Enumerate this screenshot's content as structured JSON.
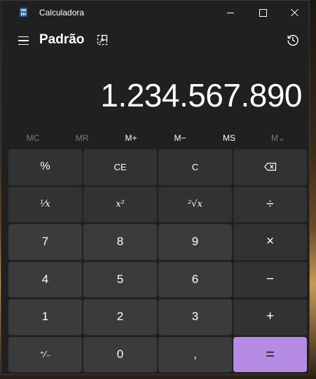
{
  "window": {
    "app_title": "Calculadora"
  },
  "header": {
    "mode": "Padrão"
  },
  "display": {
    "value": "1.234.567.890"
  },
  "memory": {
    "mc": "MC",
    "mr": "MR",
    "mplus": "M+",
    "mminus": "M−",
    "ms": "MS",
    "mlist": "M⌄"
  },
  "keys": {
    "percent": "%",
    "ce": "CE",
    "c": "C",
    "reciprocal": "⅟x",
    "square": "x²",
    "sqrt": "²√x",
    "divide": "÷",
    "seven": "7",
    "eight": "8",
    "nine": "9",
    "multiply": "×",
    "four": "4",
    "five": "5",
    "six": "6",
    "minus": "−",
    "one": "1",
    "two": "2",
    "three": "3",
    "plus": "+",
    "negate": "⁺∕₋",
    "zero": "0",
    "decimal": ",",
    "equals": "="
  },
  "icons": {
    "app": "calculator-app-icon",
    "menu": "hamburger-menu-icon",
    "keep_on_top": "keep-on-top-icon",
    "history": "history-icon",
    "backspace": "backspace-icon"
  },
  "colors": {
    "accent": "#b58be3",
    "window_bg": "#202020",
    "key_bg": "#323232",
    "number_key_bg": "#3b3b3b"
  }
}
